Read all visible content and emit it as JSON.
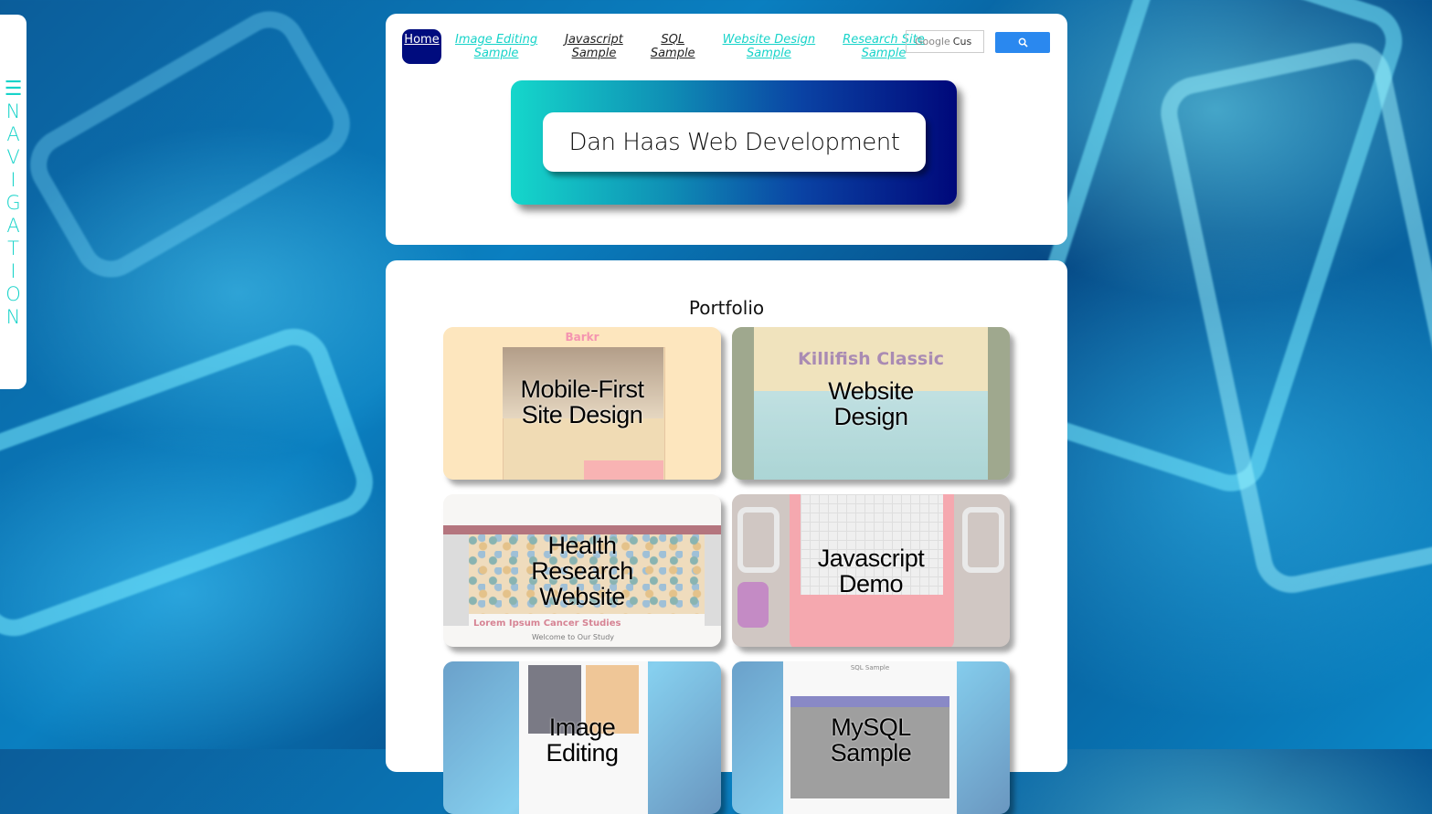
{
  "side_nav": {
    "burger": "☰",
    "letters": [
      "N",
      "A",
      "V",
      "I",
      "G",
      "A",
      "T",
      "I",
      "O",
      "N"
    ]
  },
  "topnav": {
    "home": "Home",
    "links": [
      {
        "line1": "Image Editing",
        "line2": "Sample"
      },
      {
        "line1": "Javascript",
        "line2": "Sample"
      },
      {
        "line1": "SQL",
        "line2": "Sample"
      },
      {
        "line1": "Website Design",
        "line2": "Sample"
      },
      {
        "line1": "Research Site",
        "line2": "Sample"
      }
    ],
    "search": {
      "brand": "Google",
      "value": "Cus"
    }
  },
  "banner": {
    "title": "Dan Haas Web Development"
  },
  "portfolio": {
    "title": "Portfolio",
    "tiles": [
      {
        "label1": "Mobile-First",
        "label2": "Site Design",
        "brand": "Barkr"
      },
      {
        "label1": "Website",
        "label2": "Design",
        "brand": "Killifish Classic"
      },
      {
        "label1": "Health",
        "label2": "Research",
        "label3": "Website",
        "heading": "Lorem Ipsum Cancer Studies",
        "sub": "Welcome to Our Study"
      },
      {
        "label1": "Javascript",
        "label2": "Demo"
      },
      {
        "label1": "Image",
        "label2": "Editing"
      },
      {
        "label1": "MySQL",
        "label2": "Sample",
        "heading": "SQL Sample"
      }
    ]
  },
  "colors": {
    "accent": "#17d3c9",
    "home_bg": "#000c7e",
    "search_btn": "#2a88ef"
  }
}
